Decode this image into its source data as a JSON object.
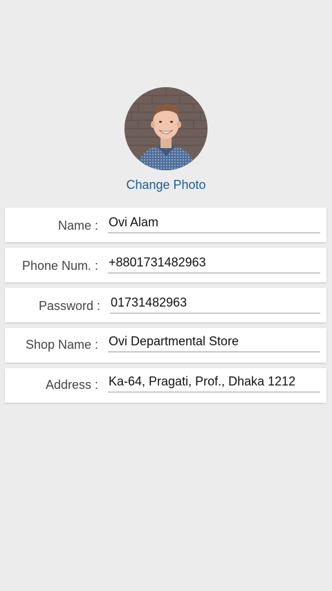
{
  "profile": {
    "change_photo_label": "Change Photo"
  },
  "form": {
    "name": {
      "label": "Name :",
      "value": "Ovi Alam"
    },
    "phone": {
      "label": "Phone Num. :",
      "value": "+8801731482963"
    },
    "password": {
      "label": "Password :",
      "value": "01731482963"
    },
    "shop_name": {
      "label": "Shop Name :",
      "value": "Ovi Departmental Store"
    },
    "address": {
      "label": "Address :",
      "value": "Ka-64, Pragati, Prof., Dhaka 1212"
    }
  },
  "colors": {
    "background": "#ececec",
    "accent": "#1f5d92",
    "card": "#ffffff"
  }
}
